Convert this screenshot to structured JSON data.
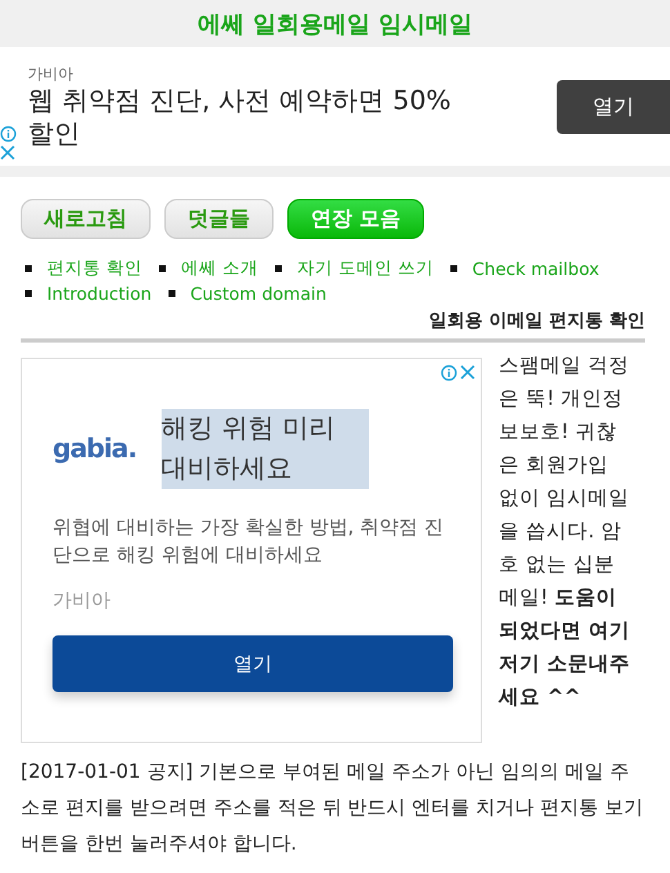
{
  "header": {
    "title": "에쎄 일회용메일 임시메일"
  },
  "top_ad": {
    "advertiser": "가비아",
    "headline": "웹 취약점 진단, 사전 예약하면 50% 할인",
    "button": "열기"
  },
  "buttons": [
    {
      "label": "새로고침",
      "kind": "default"
    },
    {
      "label": "덧글들",
      "kind": "default"
    },
    {
      "label": "연장 모음",
      "kind": "primary"
    }
  ],
  "links": [
    "편지통 확인",
    "에쎄 소개",
    "자기 도메인 쓰기",
    "Check mailbox",
    "Introduction",
    "Custom domain"
  ],
  "section_title": "일회용 이메일 편지통 확인",
  "box_ad": {
    "logo": "gabia.",
    "headline": "해킹 위험 미리 대비하세요",
    "body": "위협에 대비하는 가장 확실한 방법, 취약점 진단으로 해킹 위험에 대비하세요",
    "advertiser": "가비아",
    "button": "열기"
  },
  "side_note": "스팸메일 걱정은 뚝! 개인정보보호! 귀찮은 회원가입 없이 임시메일을 씁시다. 암호 없는 십분메일! **도움이 되었다면 여기저기 소문내주세요 ^^**",
  "notice": "[2017-01-01 공지] 기본으로 부여된 메일 주소가 아닌 임의의 메일 주소로 편지를 받으려면 주소를 적은 뒤 반드시 엔터를 치거나 편지통 보기 버튼을 한번 눌러주셔야 합니다."
}
